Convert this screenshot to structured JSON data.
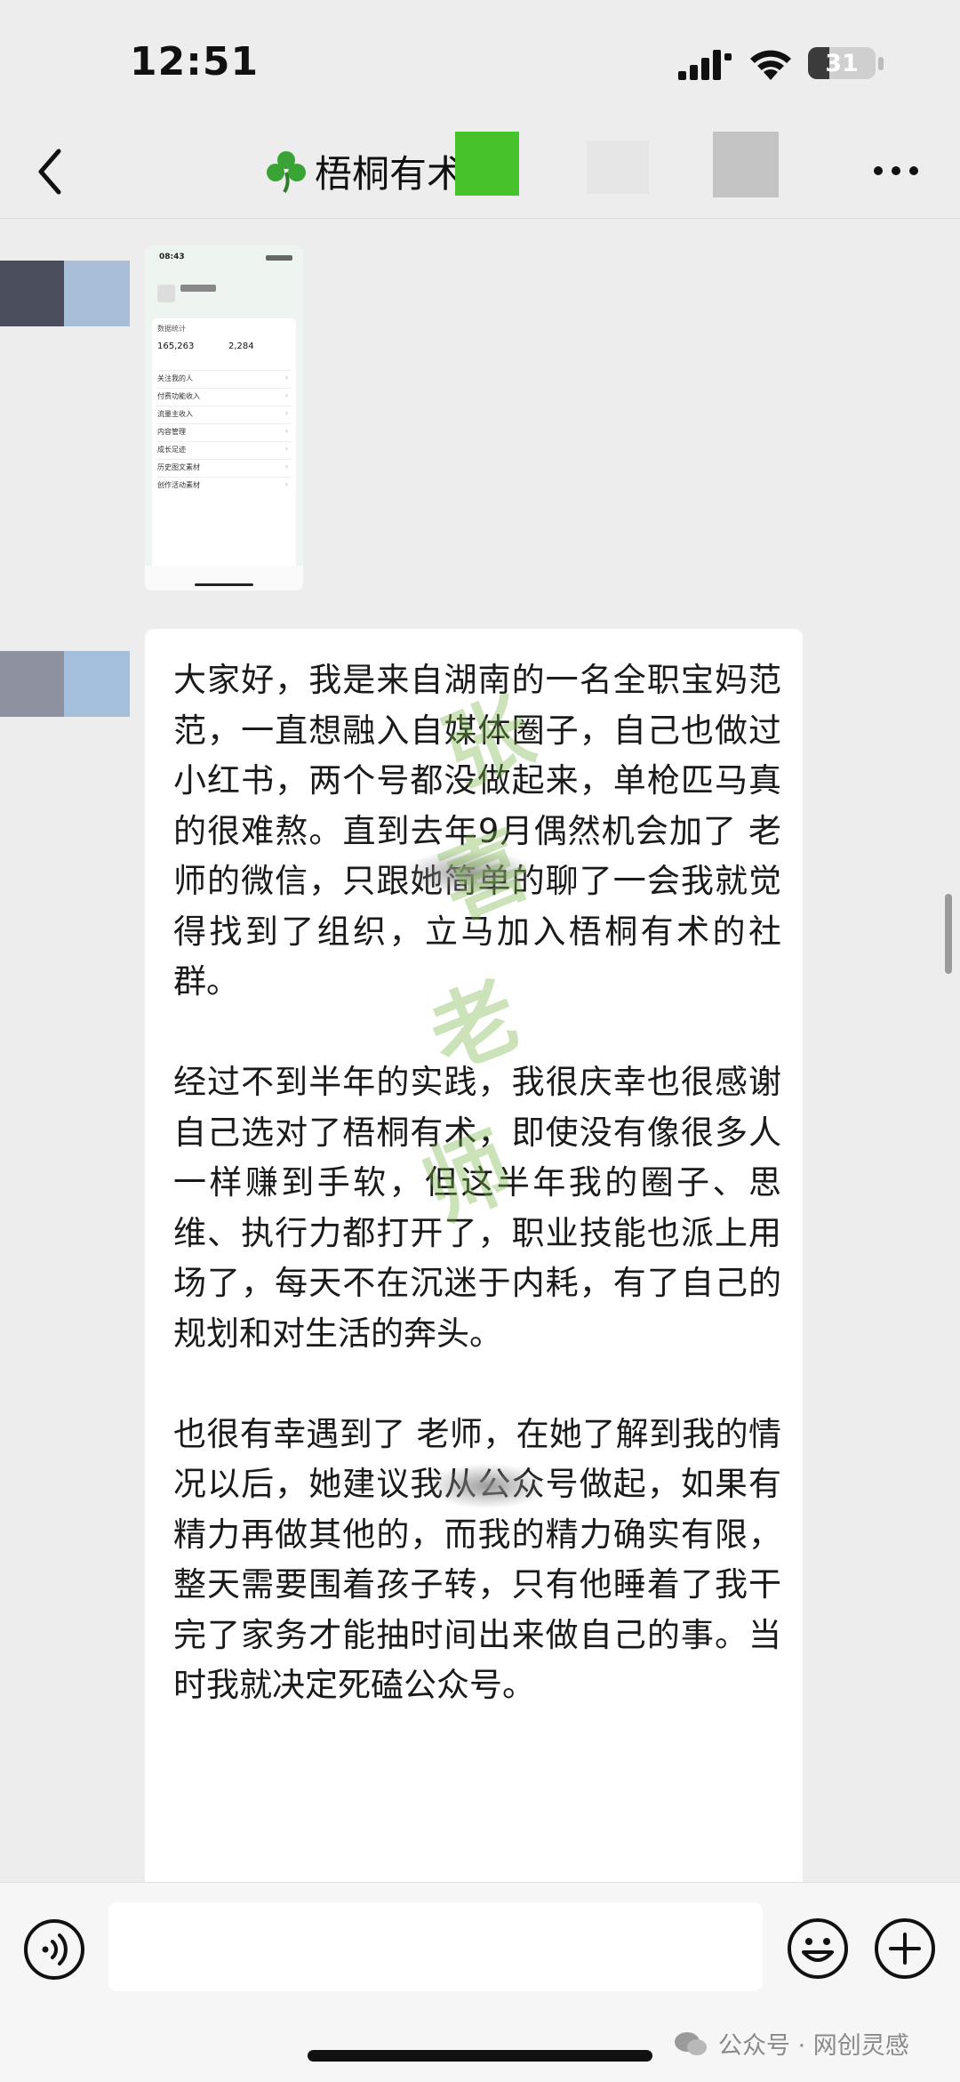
{
  "status_bar": {
    "time": "12:51",
    "battery_level": 31,
    "battery_label": "31",
    "signal_icon": "cellular-signal-icon",
    "wifi_icon": "wifi-icon"
  },
  "header": {
    "back_icon": "chevron-left-icon",
    "title_icon": "shamrock-icon",
    "title": "梧桐有术",
    "more_icon": "more-dots-icon"
  },
  "avatars": {
    "first": [
      "#4a4e5c",
      "#a8bdd8"
    ],
    "second": [
      "#8e92a0",
      "#a4bfdc"
    ]
  },
  "image_message": {
    "time": "08:43",
    "heading": "数据统计",
    "stat_a": "165,263",
    "stat_b": "2,284",
    "rows": [
      "关注我的人",
      "付费功能收入",
      "流量主收入",
      "内容管理",
      "成长足迹",
      "历史图文素材",
      "创作活动素材"
    ]
  },
  "text_message": {
    "paragraph_1": "大家好，我是来自湖南的一名全职宝妈范范，一直想融入自媒体圈子，自己也做过小红书，两个号都没做起来，单枪匹马真的很难熬。直到去年9月偶然机会加了    老师的微信，只跟她简单的聊了一会我就觉得找到了组织，立马加入梧桐有术的社群。",
    "paragraph_2": "经过不到半年的实践，我很庆幸也很感谢自己选对了梧桐有术，即使没有像很多人一样赚到手软，但这半年我的圈子、思维、执行力都打开了，职业技能也派上用场了，每天不在沉迷于内耗，有了自己的规划和对生活的奔头。",
    "paragraph_3": "也很有幸遇到了    老师，在她了解到我的情况以后，她建议我从公众号做起，如果有精力再做其他的，而我的精力确实有限，整天需要围着孩子转，只有他睡着了我干完了家务才能抽时间出来做自己的事。当时我就决定死磕公众号。",
    "watermark_chars": [
      "张",
      "喜",
      "老",
      "师"
    ]
  },
  "input_bar": {
    "voice_icon": "voice-input-icon",
    "emoji_icon": "emoji-icon",
    "plus_icon": "plus-circle-icon",
    "message_value": ""
  },
  "source_watermark": {
    "icon": "wechat-official-account-icon",
    "text": "公众号 · 网创灵感"
  },
  "colors": {
    "background": "#ededed",
    "bubble": "#ffffff",
    "watermark_green": "#78b446",
    "mosaic_green": "#46c32a"
  }
}
